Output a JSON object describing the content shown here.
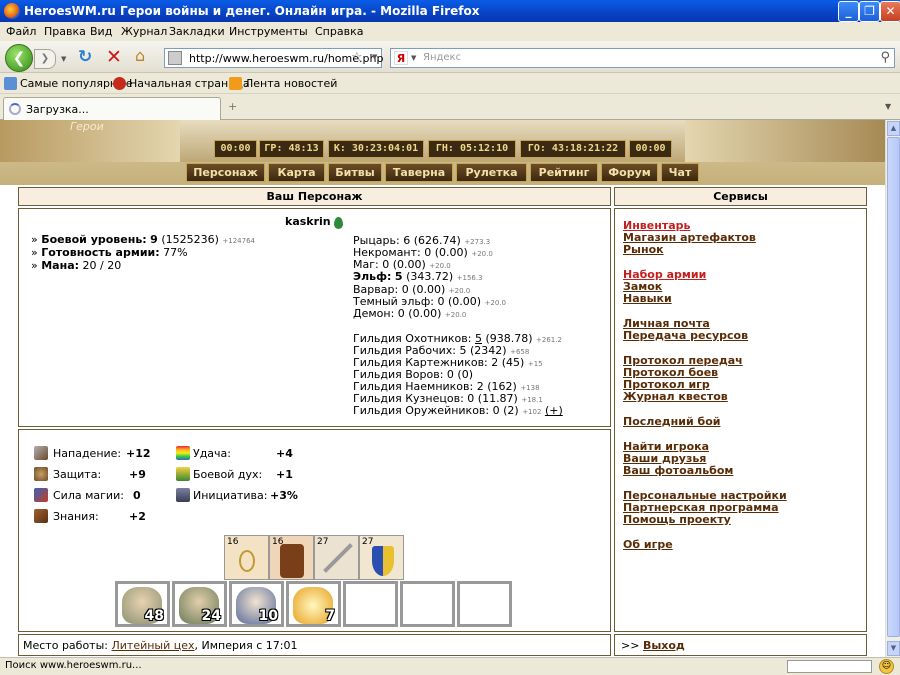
{
  "window": {
    "title": "HeroesWM.ru Герои войны и денег. Онлайн игра. - Mozilla Firefox",
    "minimize": "_",
    "maximize": "❐",
    "close": "✕"
  },
  "menu": [
    "Файл",
    "Правка",
    "Вид",
    "Журнал",
    "Закладки",
    "Инструменты",
    "Справка"
  ],
  "nav": {
    "url": "http://www.heroeswm.ru/home.php",
    "search_placeholder": "Яндекс",
    "search_engine_icon": "Я"
  },
  "bookmarks": [
    "Самые популярные",
    "Начальная страница",
    "Лента новостей"
  ],
  "tab": {
    "label": "Загрузка...",
    "new_tab": "+"
  },
  "banner": {
    "logo": "Герои",
    "timers": [
      "00:00",
      "ГР: 48:13",
      "К: 30:23:04:01",
      "ГН: 05:12:10",
      "ГО: 43:18:21:22",
      "00:00"
    ],
    "nav": [
      "Персонаж",
      "Карта",
      "Битвы",
      "Таверна",
      "Рулетка",
      "Рейтинг",
      "Форум",
      "Чат"
    ]
  },
  "character": {
    "header": "Ваш Персонаж",
    "name": "kaskrin",
    "combat_level_label": "Боевой уровень:",
    "combat_level": "9",
    "combat_exp": "(1525236)",
    "combat_exp_delta": "+124764",
    "army_ready_label": "Готовность армии:",
    "army_ready": "77%",
    "mana_label": "Мана:",
    "mana": "20 / 20",
    "factions": [
      {
        "name": "Рыцарь:",
        "value": "6 (626.74)",
        "delta": "+273.3",
        "bold": false
      },
      {
        "name": "Некромант:",
        "value": "0 (0.00)",
        "delta": "+20.0",
        "bold": false
      },
      {
        "name": "Маг:",
        "value": "0 (0.00)",
        "delta": "+20.0",
        "bold": false
      },
      {
        "name": "Эльф:",
        "value": "5",
        "value2": "(343.72)",
        "delta": "+156.3",
        "bold": true
      },
      {
        "name": "Варвар:",
        "value": "0 (0.00)",
        "delta": "+20.0",
        "bold": false
      },
      {
        "name": "Темный эльф:",
        "value": "0 (0.00)",
        "delta": "+20.0",
        "bold": false
      },
      {
        "name": "Демон:",
        "value": "0 (0.00)",
        "delta": "+20.0",
        "bold": false
      }
    ],
    "guilds": [
      {
        "name": "Гильдия Охотников:",
        "value": "5",
        "value2": "(938.78)",
        "delta": "+261.2"
      },
      {
        "name": "Гильдия Рабочих:",
        "value": "5 (2342)",
        "delta": "+658"
      },
      {
        "name": "Гильдия Картежников:",
        "value": "2 (45)",
        "delta": "+15"
      },
      {
        "name": "Гильдия Воров:",
        "value": "0 (0)",
        "delta": ""
      },
      {
        "name": "Гильдия Наемников:",
        "value": "2 (162)",
        "delta": "+138"
      },
      {
        "name": "Гильдия Кузнецов:",
        "value": "0 (11.87)",
        "delta": "+18.1"
      },
      {
        "name": "Гильдия Оружейников:",
        "value": "0 (2)",
        "delta": "+102",
        "extra": "(+)"
      }
    ]
  },
  "stats": {
    "attack_label": "Нападение:",
    "attack": "+12",
    "defense_label": "Защита:",
    "defense": "+9",
    "magic_label": "Сила магии:",
    "magic": "0",
    "knowledge_label": "Знания:",
    "knowledge": "+2",
    "luck_label": "Удача:",
    "luck": "+4",
    "morale_label": "Боевой дух:",
    "morale": "+1",
    "initiative_label": "Инициатива:",
    "initiative": "+3%"
  },
  "artifacts": [
    {
      "level": "16",
      "icon": "amulet-icon"
    },
    {
      "level": "16",
      "icon": "leather-armor-icon"
    },
    {
      "level": "27",
      "icon": "sword-icon"
    },
    {
      "level": "27",
      "icon": "shield-icon"
    }
  ],
  "army": [
    {
      "count": "48",
      "icon": "elf-archer-icon"
    },
    {
      "count": "24",
      "icon": "elf-ranger-icon"
    },
    {
      "count": "10",
      "icon": "druid-icon"
    },
    {
      "count": "7",
      "icon": "unicorn-icon"
    },
    {
      "count": "",
      "icon": "empty-slot"
    },
    {
      "count": "",
      "icon": "empty-slot"
    },
    {
      "count": "",
      "icon": "empty-slot"
    }
  ],
  "workplace": {
    "label": "Место работы:",
    "link": "Литейный цех",
    "suffix": ", Империя с 17:01"
  },
  "services": {
    "header": "Сервисы",
    "groups": [
      [
        {
          "label": "Инвентарь",
          "red": true
        },
        {
          "label": "Магазин артефактов",
          "red": false
        },
        {
          "label": "Рынок",
          "red": false
        }
      ],
      [
        {
          "label": "Набор армии",
          "red": true
        },
        {
          "label": "Замок",
          "red": false
        },
        {
          "label": "Навыки",
          "red": false
        }
      ],
      [
        {
          "label": "Личная почта",
          "red": false
        },
        {
          "label": "Передача ресурсов",
          "red": false
        }
      ],
      [
        {
          "label": "Протокол передач",
          "red": false
        },
        {
          "label": "Протокол боев",
          "red": false
        },
        {
          "label": "Протокол игр",
          "red": false
        },
        {
          "label": "Журнал квестов",
          "red": false
        }
      ],
      [
        {
          "label": "Последний бой",
          "red": false
        }
      ],
      [
        {
          "label": "Найти игрока",
          "red": false
        },
        {
          "label": "Ваши друзья",
          "red": false
        },
        {
          "label": "Ваш фотоальбом",
          "red": false
        }
      ],
      [
        {
          "label": "Персональные настройки",
          "red": false
        },
        {
          "label": "Партнерская программа",
          "red": false
        },
        {
          "label": "Помощь проекту",
          "red": false
        }
      ],
      [
        {
          "label": "Об игре",
          "red": false
        }
      ]
    ],
    "logout_prefix": ">>",
    "logout": "Выход"
  },
  "status": {
    "text": "Поиск www.heroeswm.ru..."
  }
}
